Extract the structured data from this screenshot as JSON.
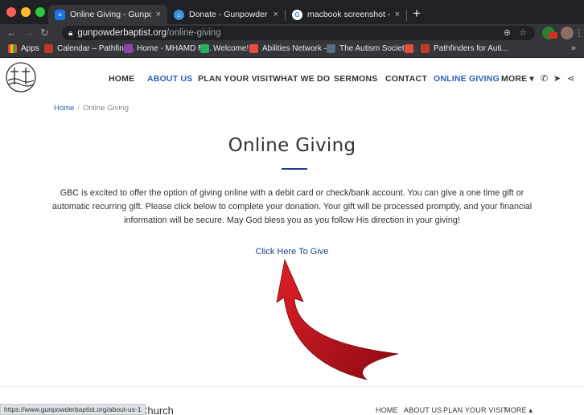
{
  "browser": {
    "tabs": [
      {
        "title": "Online Giving - Gunpowder Bapti",
        "favicon_color": "#1a73e8",
        "active": true
      },
      {
        "title": "Donate - Gunpowder Baptist Ch",
        "favicon_color": "#3a8fd6",
        "active": false
      },
      {
        "title": "macbook screenshot - Google S",
        "favicon_color": "#ffffff",
        "active": false
      }
    ],
    "tab_close_glyph": "×",
    "new_tab_glyph": "+",
    "address": {
      "host": "gunpowderbaptist.org",
      "path": "/online-giving"
    },
    "bookmarks": [
      {
        "label": "Apps",
        "icon_color": "#fbbc04"
      },
      {
        "label": "Calendar – Pathfind...",
        "icon_color": "#c0392b"
      },
      {
        "label": "Home - MHAMD M...",
        "icon_color": "#8e44ad"
      },
      {
        "label": "Welcome!",
        "icon_color": "#27ae60"
      },
      {
        "label": "Abilities Network –...",
        "icon_color": "#e74c3c"
      },
      {
        "label": "The Autism Society...",
        "icon_color": "#5d6d7e"
      },
      {
        "label": "Pathfinders for Auti...",
        "icon_color": "#c0392b"
      }
    ],
    "bookmarks_more": "»",
    "status_url": "https://www.gunpowderbaptist.org/about-us-1"
  },
  "site": {
    "nav": [
      {
        "label": "HOME",
        "state": "normal"
      },
      {
        "label": "ABOUT US",
        "state": "hover"
      },
      {
        "label": "PLAN YOUR VISIT",
        "state": "normal"
      },
      {
        "label": "WHAT WE DO",
        "state": "normal"
      },
      {
        "label": "SERMONS",
        "state": "normal"
      },
      {
        "label": "CONTACT",
        "state": "normal"
      },
      {
        "label": "ONLINE GIVING",
        "state": "active"
      },
      {
        "label": "MORE ▾",
        "state": "normal"
      }
    ],
    "nav_icons": [
      "phone-icon",
      "send-icon",
      "share-icon"
    ],
    "breadcrumb": {
      "home": "Home",
      "separator": "/",
      "current": "Online Giving"
    },
    "title": "Online Giving",
    "intro": "GBC is excited to offer the option of giving online with a debit card or check/bank account.  You can give a one time gift or automatic recurring gift.  Please click below to complete your donation. Your gift will be processed promptly, and your financial information will be secure. May God bless you as you follow His direction in your giving!",
    "give_link": "Click Here To Give",
    "footer_name": "Church",
    "footer_nav": [
      "HOME",
      "ABOUT US",
      "PLAN YOUR VISIT",
      "MORE ▴"
    ],
    "colors": {
      "accent": "#1e3f8c",
      "active_link": "#2d5fb5",
      "arrow": "#c8102e"
    }
  }
}
